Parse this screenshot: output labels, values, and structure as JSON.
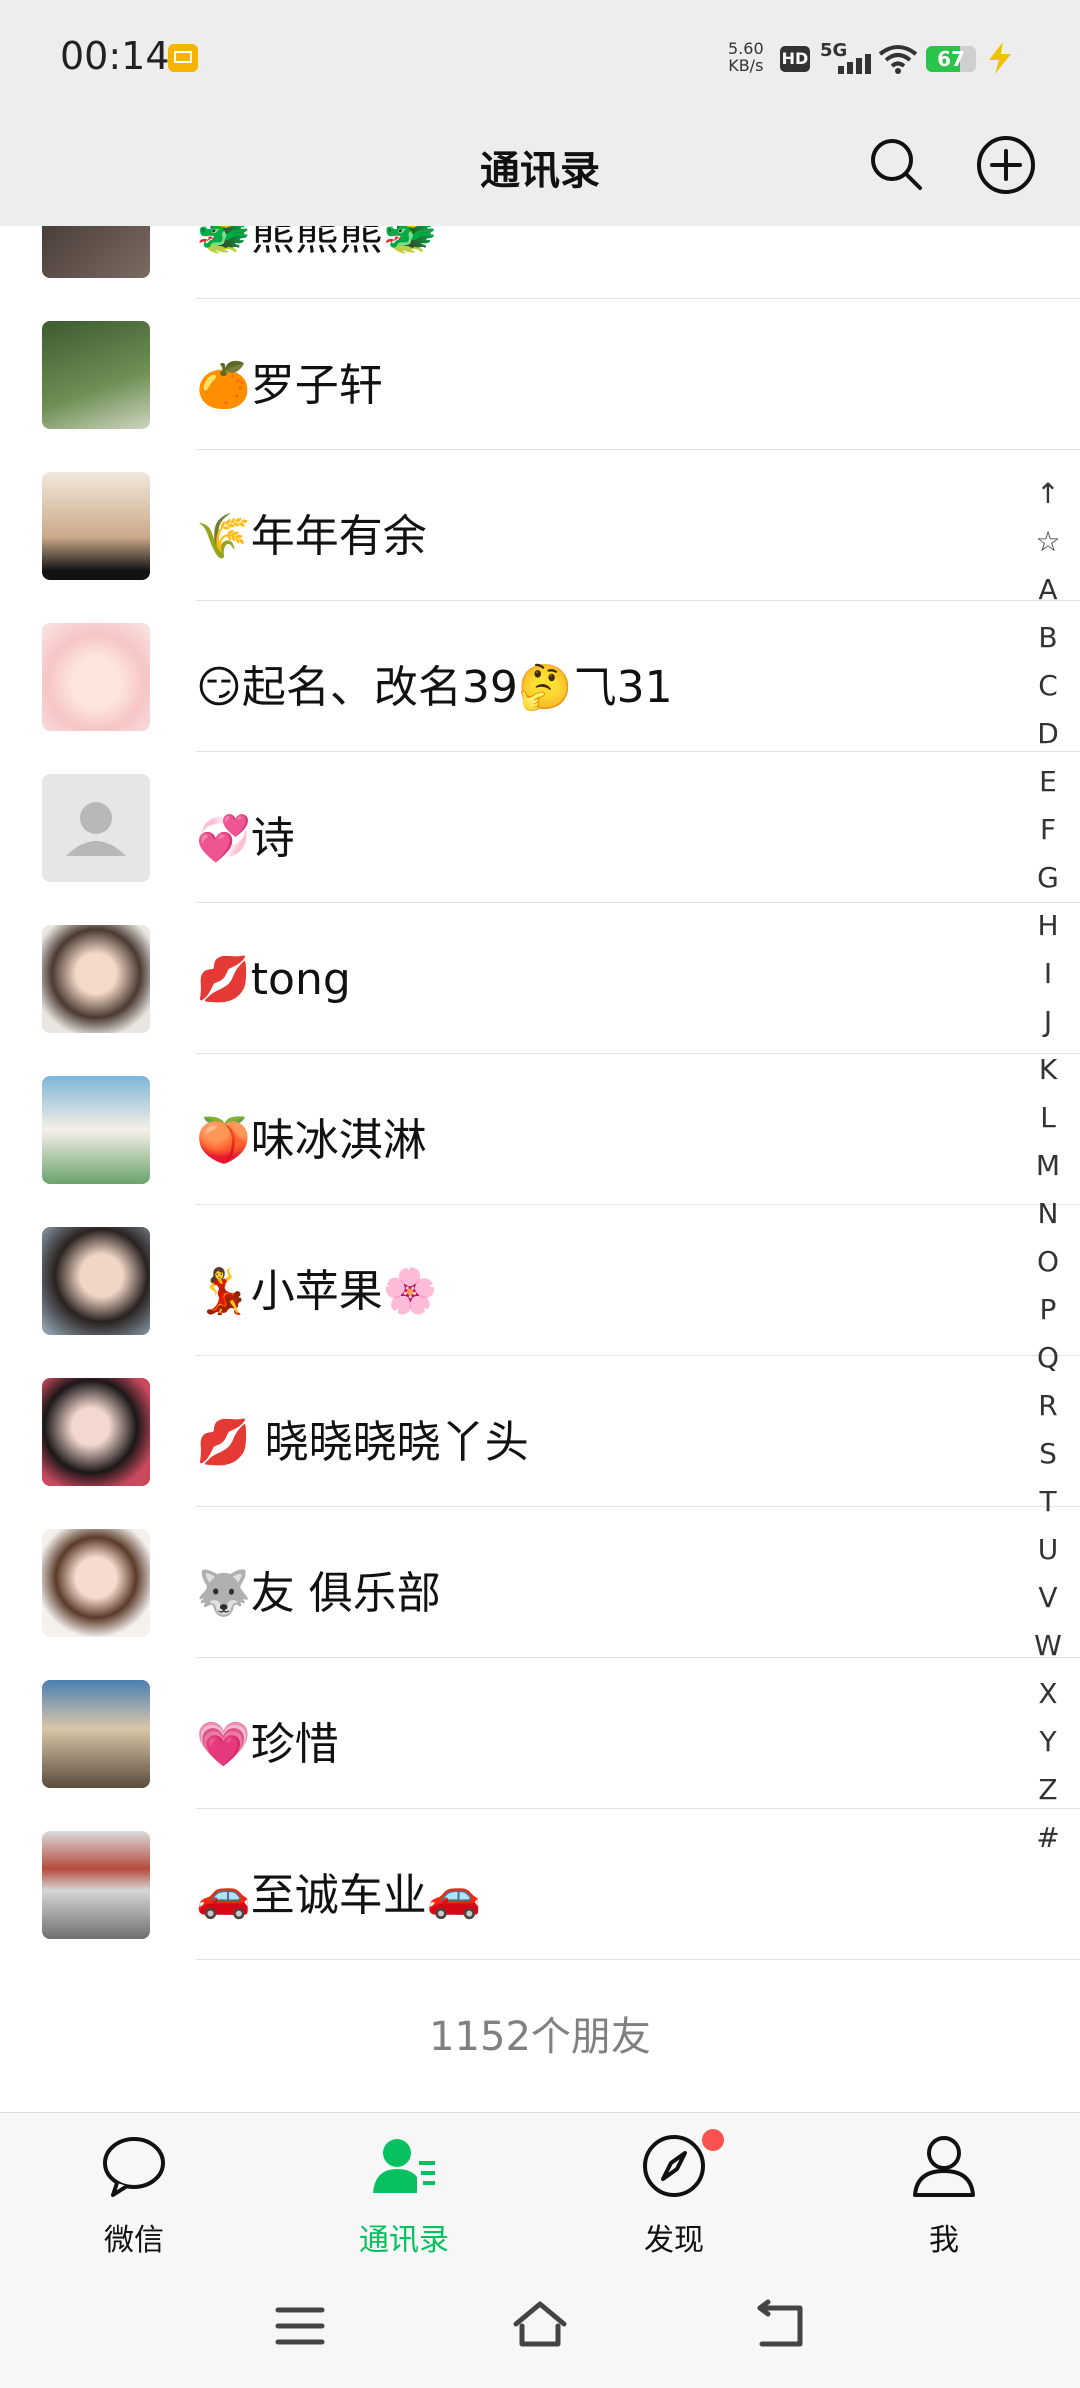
{
  "status_bar": {
    "time": "00:14",
    "net_speed_value": "5.60",
    "net_speed_unit": "KB/s",
    "hd_label": "HD",
    "signal_label": "5G",
    "battery_level": "67"
  },
  "header": {
    "title": "通讯录"
  },
  "contacts": [
    {
      "name": "🐲熊熊熊🐲"
    },
    {
      "name": "🍊罗子轩"
    },
    {
      "name": "🌾年年有余"
    },
    {
      "name": "😏起名、改名39🤔⺄31"
    },
    {
      "name": "💞诗"
    },
    {
      "name": "💋tong"
    },
    {
      "name": "🍑味冰淇淋"
    },
    {
      "name": "💃小苹果🌸"
    },
    {
      "name": "💋 晓晓晓晓丫头"
    },
    {
      "name": "🐺友 俱乐部"
    },
    {
      "name": "💗珍惜"
    },
    {
      "name": "🚗至诚车业🚗"
    }
  ],
  "index_letters": [
    "↑",
    "☆",
    "A",
    "B",
    "C",
    "D",
    "E",
    "F",
    "G",
    "H",
    "I",
    "J",
    "K",
    "L",
    "M",
    "N",
    "O",
    "P",
    "Q",
    "R",
    "S",
    "T",
    "U",
    "V",
    "W",
    "X",
    "Y",
    "Z",
    "#"
  ],
  "friend_count": "1152个朋友",
  "tabs": [
    {
      "label": "微信",
      "icon": "chat-bubble-icon"
    },
    {
      "label": "通讯录",
      "icon": "contacts-icon"
    },
    {
      "label": "发现",
      "icon": "compass-icon"
    },
    {
      "label": "我",
      "icon": "person-icon"
    }
  ],
  "colors": {
    "accent": "#07c160",
    "badge": "#fa5151",
    "background": "#ededed"
  }
}
